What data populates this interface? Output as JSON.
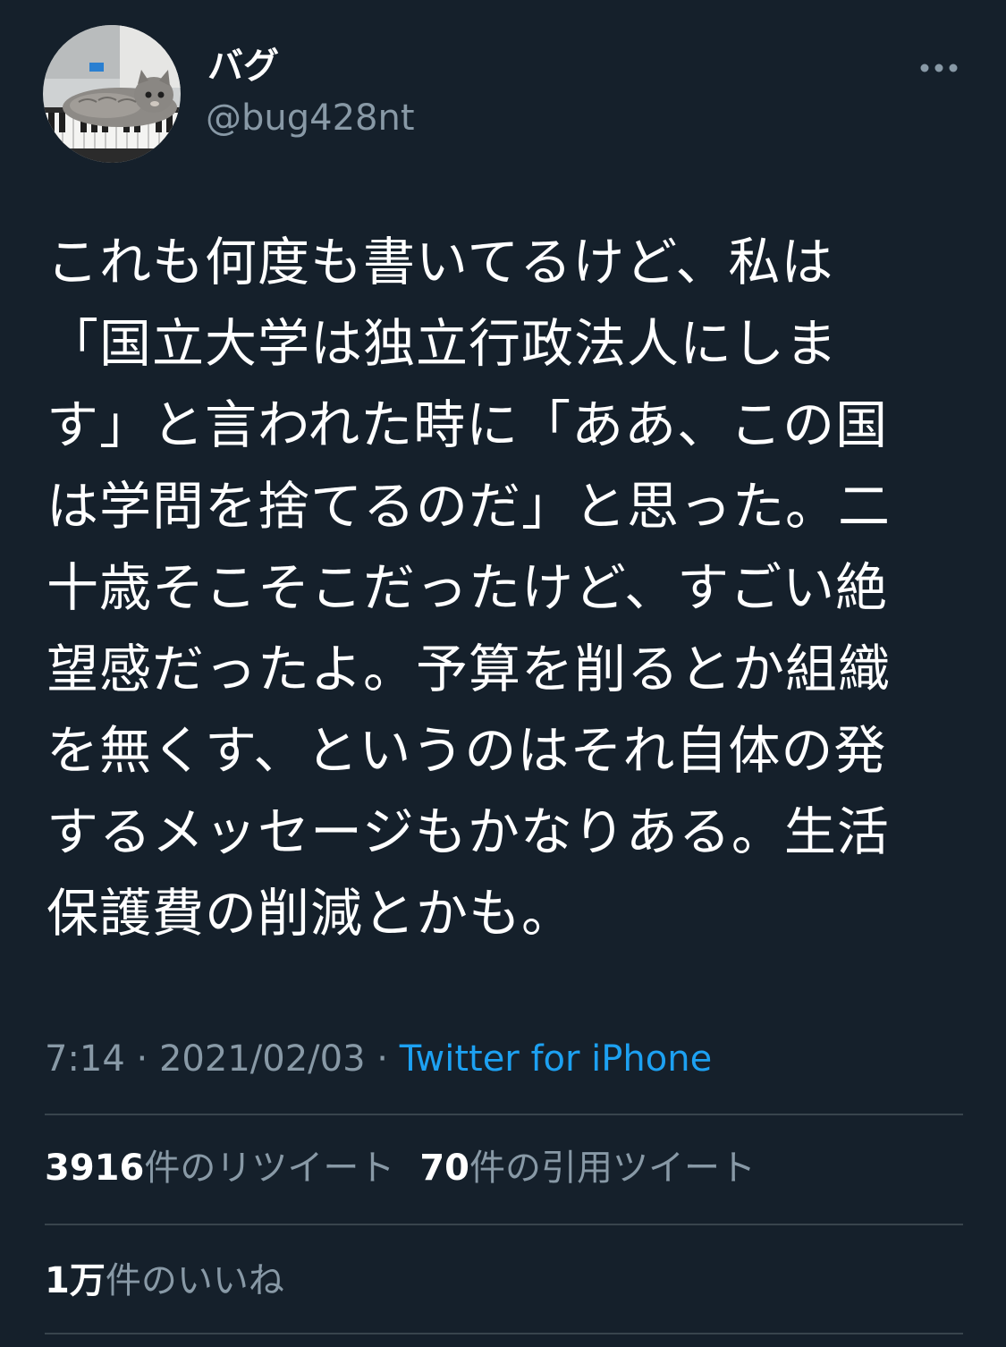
{
  "user": {
    "display_name": "バグ",
    "handle": "@bug428nt",
    "avatar": "cat-on-piano-keyboard-photo"
  },
  "tweet": {
    "lines": [
      "これも何度も書いてるけど、私は",
      "「国立大学は独立行政法人にしま",
      "す」と言われた時に「ああ、この国",
      "は学問を捨てるのだ」と思った。二",
      "十歳そこそこだったけど、すごい絶",
      "望感だったよ。予算を削るとか組織",
      "を無くす、というのはそれ自体の発",
      "するメッセージもかなりある。生活",
      "保護費の削減とかも。"
    ],
    "time": "7:14",
    "separator": "·",
    "date": "2021/02/03",
    "source": "Twitter for iPhone"
  },
  "stats": {
    "retweets": {
      "count": "3916",
      "label": "件のリツイート"
    },
    "quotes": {
      "count": "70",
      "label": "件の引用ツイート"
    },
    "likes": {
      "count": "1万",
      "label": "件のいいね"
    }
  },
  "colors": {
    "background": "#15202b",
    "text": "#ffffff",
    "secondary": "#8899a6",
    "accent": "#1da1f2",
    "divider": "#38444d"
  },
  "icons": {
    "more": "more-horizontal-icon"
  }
}
